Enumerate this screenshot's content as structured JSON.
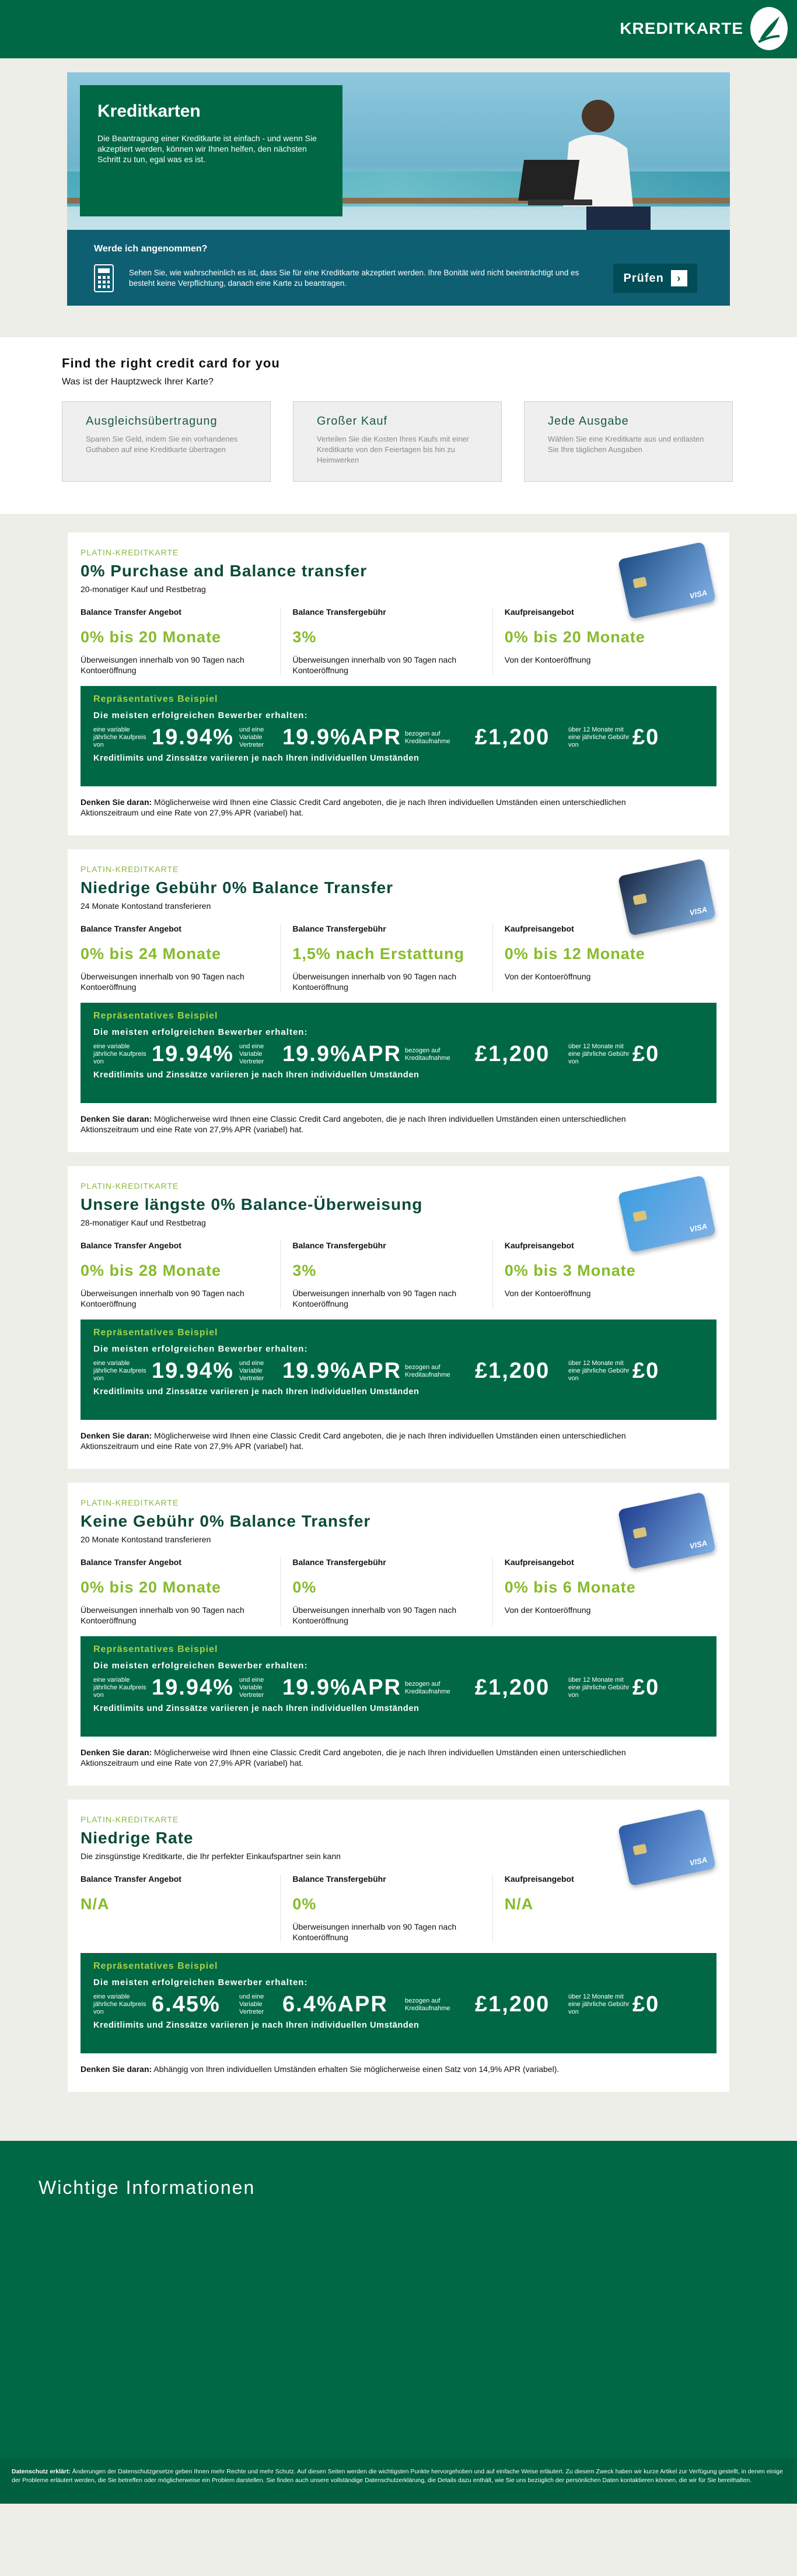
{
  "header": {
    "brand": "KREDITKARTE"
  },
  "hero": {
    "title": "Kreditkarten",
    "text": "Die Beantragung einer Kreditkarte ist einfach - und wenn Sie akzeptiert werden, können wir Ihnen helfen, den nächsten Schritt zu tun, egal was es ist.",
    "question": "Werde ich angenommen?",
    "info": "Sehen Sie, wie wahrscheinlich es ist, dass Sie für eine Kreditkarte akzeptiert werden.  Ihre Bonität wird nicht beeinträchtigt und es besteht keine Verpflichtung, danach eine Karte zu beantragen.",
    "button": "Prüfen",
    "button_arrow": "›"
  },
  "finder": {
    "title": "Find the right credit card for you",
    "question": "Was ist der Hauptzweck Ihrer Karte?",
    "options": [
      {
        "title": "Ausgleichsübertragung",
        "text": "Sparen Sie Geld, indem Sie ein vorhandenes Guthaben auf eine Kreditkarte übertragen"
      },
      {
        "title": "Großer Kauf",
        "text": "Verteilen Sie die Kosten Ihres Kaufs mit einer Kreditkarte von den Feiertagen bis hin zu Heimwerken"
      },
      {
        "title": "Jede Ausgabe",
        "text": "Wählen Sie eine Kreditkarte aus und entlasten Sie Ihre täglichen Ausgaben"
      }
    ]
  },
  "common": {
    "rep_title": "Repräsentatives Beispiel",
    "rep_sub": "Die meisten erfolgreichen Bewerber erhalten:",
    "rep_small1": "eine variable jährliche Kaufpreis von",
    "rep_small2": "und eine Variable Vertreter",
    "rep_small3": "bezogen auf Kreditaufnahme",
    "rep_small4": "über 12 Monate mit eine jährliche Gebühr von",
    "rep_bottom": "Kreditlimits und Zinssätze variieren je nach Ihren individuellen Umständen",
    "remark_label": "Denken Sie daran:",
    "remark_text": "Möglicherweise wird Ihnen eine Classic Credit Card angeboten, die je nach Ihren individuellen Umständen einen unterschiedlichen Aktionszeitraum und eine Rate von 27,9% APR (variabel) hat.",
    "f1_label": "Balance Transfer Angebot",
    "f2_label": "Balance Transfergebühr",
    "f3_label": "Kaufpreisangebot",
    "note_90": "Überweisungen innerhalb von 90 Tagen nach Kontoeröffnung",
    "note_open": "Von der Kontoeröffnung"
  },
  "products": [
    {
      "kicker": "PLATIN-KREDITKARTE",
      "title": "0% Purchase and Balance transfer",
      "sub": "20-monatiger Kauf und Restbetrag",
      "f1": "0% bis 20 Monate",
      "f2": "3%",
      "f3": "0% bis 20 Monate",
      "rate1": "19.94%",
      "rate2": "19.9%APR",
      "amount": "£1,200",
      "fee": "£0"
    },
    {
      "kicker": "PLATIN-KREDITKARTE",
      "title": "Niedrige Gebühr 0% Balance Transfer",
      "sub": "24 Monate Kontostand transferieren",
      "f1": "0% bis 24 Monate",
      "f2": "1,5% nach Erstattung",
      "f3": "0% bis 12 Monate",
      "rate1": "19.94%",
      "rate2": "19.9%APR",
      "amount": "£1,200",
      "fee": "£0"
    },
    {
      "kicker": "PLATIN-KREDITKARTE",
      "title": "Unsere längste 0% Balance-Überweisung",
      "sub": "28-monatiger Kauf und Restbetrag",
      "f1": "0% bis 28 Monate",
      "f2": "3%",
      "f3": "0% bis 3 Monate",
      "rate1": "19.94%",
      "rate2": "19.9%APR",
      "amount": "£1,200",
      "fee": "£0"
    },
    {
      "kicker": "PLATIN-KREDITKARTE",
      "title": "Keine Gebühr 0% Balance Transfer",
      "sub": "20 Monate Kontostand transferieren",
      "f1": "0% bis 20 Monate",
      "f2": "0%",
      "f3": "0% bis 6 Monate",
      "rate1": "19.94%",
      "rate2": "19.9%APR",
      "amount": "£1,200",
      "fee": "£0"
    },
    {
      "kicker": "PLATIN-KREDITKARTE",
      "title": "Niedrige Rate",
      "sub": "Die zinsgünstige Kreditkarte, die Ihr perfekter Einkaufspartner sein kann",
      "f1": "N/A",
      "f2": "0%",
      "f3": "N/A",
      "rate1": "6.45%",
      "rate2": "6.4%APR",
      "amount": "£1,200",
      "fee": "£0",
      "remark_text": "Abhängig von Ihren individuellen Umständen erhalten Sie möglicherweise einen Satz von 14,9% APR (variabel)."
    }
  ],
  "info": {
    "title": "Wichtige Informationen"
  },
  "footer": {
    "label": "Datenschutz erklärt:",
    "text": "Änderungen der Datenschutzgesetze geben Ihnen mehr Rechte und mehr Schutz.  Auf diesen Seiten werden die wichtigsten Punkte hervorgehoben und auf einfache Weise erläutert. Zu diesem Zweck haben wir kurze Artikel zur Verfügung gestellt, in denen einige der Probleme erläutert werden, die Sie betreffen oder möglicherweise ein Problem darstellen.  Sie finden auch unsere vollständige Datenschutzerklärung, die Details dazu enthält, wie Sie uns bezüglich der persönlichen Daten kontaktieren können, die wir für Sie bereithalten."
  },
  "colors": {
    "brand_green": "#006845",
    "accent_lime": "#86bb2b",
    "hero_teal": "#0f5f73"
  }
}
